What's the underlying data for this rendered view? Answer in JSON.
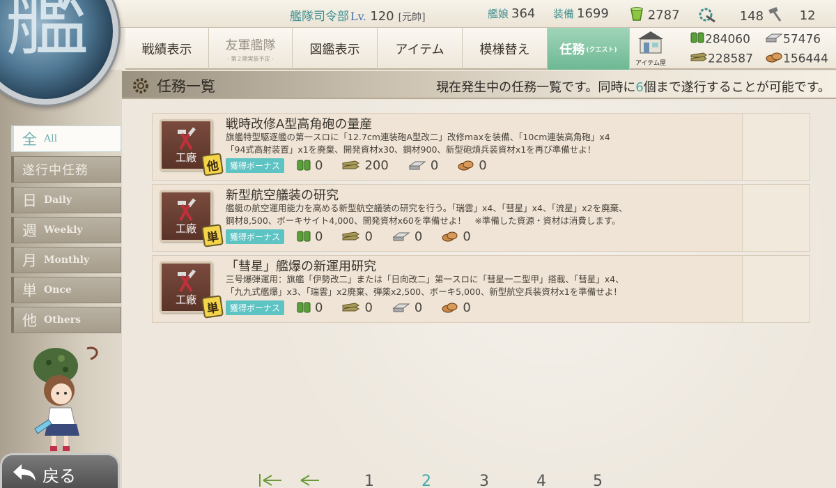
{
  "status": {
    "hq_label": "艦隊司令部",
    "lv_label": "Lv.",
    "level": "120",
    "rank": "[元帥]",
    "ships_label": "艦娘",
    "ships": "364",
    "equip_label": "装備",
    "equip": "1699",
    "buckets": "2787",
    "dev_mats": "148",
    "screws": "12"
  },
  "nav": {
    "tabs": [
      "戦績表示",
      "友軍艦隊",
      "図鑑表示",
      "アイテム",
      "模様替え",
      "任務"
    ],
    "fleet_sub": "- 第２期実装予定 -",
    "quest_en": "(クエスト)",
    "shop_label": "アイテム屋"
  },
  "materials": {
    "fuel": "284060",
    "ammo": "228587",
    "steel": "57476",
    "bauxite": "156444"
  },
  "header": {
    "title": "任務一覧",
    "msg_pre": "現在発生中の任務一覧です。同時に",
    "msg_num": "6",
    "msg_post": "個まで遂行することが可能です。"
  },
  "sidebar": {
    "categories": [
      {
        "kanji": "全",
        "en": "All"
      },
      {
        "kanji": "遂行中任務",
        "en": ""
      },
      {
        "kanji": "日",
        "en": "Daily"
      },
      {
        "kanji": "週",
        "en": "Weekly"
      },
      {
        "kanji": "月",
        "en": "Monthly"
      },
      {
        "kanji": "単",
        "en": "Once"
      },
      {
        "kanji": "他",
        "en": "Others"
      }
    ],
    "back_label": "戻る"
  },
  "quests": [
    {
      "badge": "工廠",
      "type": "他",
      "title": "戦時改修A型高角砲の量産",
      "desc1": "旗艦特型駆逐艦の第一スロに「12.7cm連装砲A型改二」改修maxを装備、「10cm連装高角砲」x4",
      "desc2": "「94式高射装置」x1を廃棄、開発資材x30、鋼材900、新型砲熕兵装資材x1を再び準備せよ！",
      "bonus": "獲得ボーナス",
      "fuel": "0",
      "ammo": "200",
      "steel": "0",
      "bauxite": "0"
    },
    {
      "badge": "工廠",
      "type": "単",
      "title": "新型航空艤装の研究",
      "desc1": "艦艇の航空運用能力を高める新型航空艤装の研究を行う。「瑞雲」x4、「彗星」x4、「流星」x2を廃棄、",
      "desc2": "鋼材8,500、ボーキサイト4,000、開発資材x60を準備せよ！　※準備した資源・資材は消費します。",
      "bonus": "獲得ボーナス",
      "fuel": "0",
      "ammo": "0",
      "steel": "0",
      "bauxite": "0"
    },
    {
      "badge": "工廠",
      "type": "単",
      "title": "「彗星」艦爆の新運用研究",
      "desc1": "三号爆弾運用：旗艦「伊勢改二」または「日向改二」第一スロに「彗星一二型甲」搭載、「彗星」x4、",
      "desc2": "「九九式艦爆」x3、「瑞雲」x2廃棄、弾薬x2,500、ボーキ5,000、新型航空兵装資材x1を準備せよ！",
      "bonus": "獲得ボーナス",
      "fuel": "0",
      "ammo": "0",
      "steel": "0",
      "bauxite": "0"
    }
  ],
  "pager": {
    "pages": [
      "1",
      "2",
      "3",
      "4",
      "5"
    ],
    "current": "2"
  }
}
